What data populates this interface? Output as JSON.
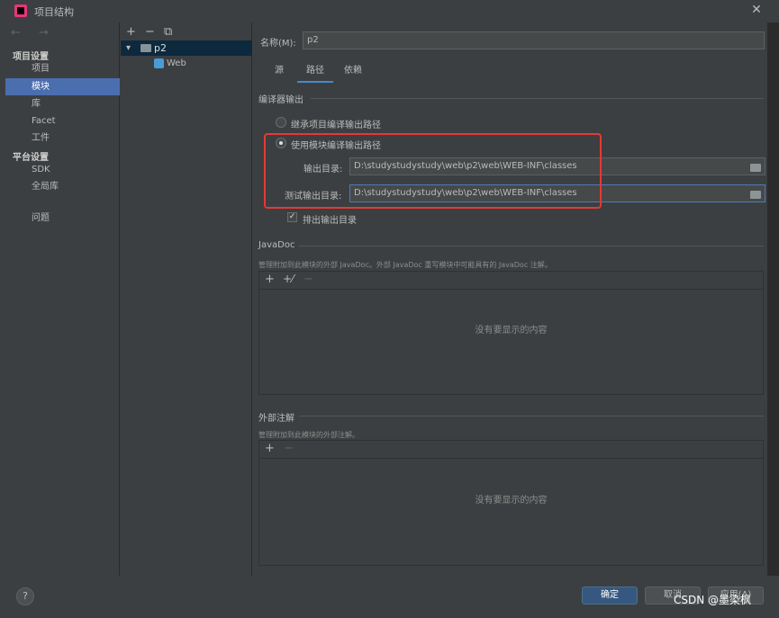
{
  "window": {
    "title": "项目结构",
    "close_glyph": "✕"
  },
  "nav": {
    "arrows": "← →",
    "project_settings_header": "项目设置",
    "project_settings_items": [
      "项目",
      "模块",
      "库",
      "Facet",
      "工件"
    ],
    "selected_item": "模块",
    "platform_settings_header": "平台设置",
    "platform_settings_items": [
      "SDK",
      "全局库"
    ],
    "problems_item": "问题"
  },
  "tree": {
    "toolbar": {
      "add": "+",
      "remove": "−",
      "copy": "⧉"
    },
    "module": {
      "expander": "▾",
      "name": "p2"
    },
    "facet": {
      "name": "Web"
    }
  },
  "module": {
    "name_label": "名称(M):",
    "name_value": "p2",
    "tabs": [
      "源",
      "路径",
      "依赖"
    ],
    "active_tab": "路径",
    "compiler_output": {
      "section_title": "编译器输出",
      "inherit_option": "继承项目编译输出路径",
      "module_option": "使用模块编译输出路径",
      "selected": "module",
      "output_label": "输出目录:",
      "output_path": "D:\\studystudystudy\\web\\p2\\web\\WEB-INF\\classes",
      "test_output_label": "测试输出目录:",
      "test_output_path": "D:\\studystudystudy\\web\\p2\\web\\WEB-INF\\classes",
      "exclude_label": "排出输出目录",
      "exclude_checked": true
    },
    "javadoc": {
      "section_title": "JavaDoc",
      "description": "管理附加到此模块的外部 JavaDoc。外部 JavaDoc 重写模块中可能具有的 JavaDoc 注解。",
      "toolbar": {
        "add": "+",
        "add_url": "+⁄",
        "remove": "−"
      },
      "empty_text": "没有要显示的内容"
    },
    "external_annotations": {
      "section_title": "外部注解",
      "description": "管理附加到此模块的外部注解。",
      "toolbar": {
        "add": "+",
        "remove": "−"
      },
      "empty_text": "没有要显示的内容"
    }
  },
  "footer": {
    "help": "?",
    "ok_label": "确定",
    "cancel_label": "取消",
    "apply_label": "应用(A)",
    "watermark": "CSDN @墨染枫"
  },
  "colors": {
    "accent": "#4b6eaf",
    "highlight_box": "#e53935",
    "primary_button": "#365880"
  }
}
